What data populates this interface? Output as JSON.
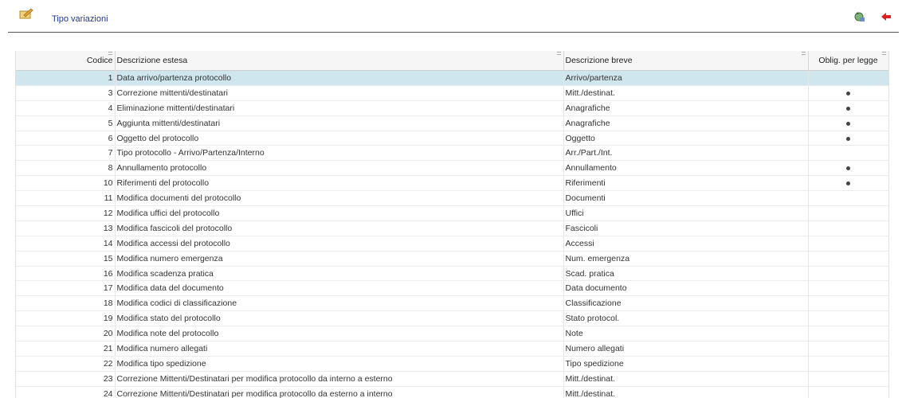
{
  "header": {
    "title": "Tipo variazioni",
    "logo_icon": "edit-pencil-icon",
    "refresh_icon": "refresh-icon",
    "exit_icon": "exit-icon"
  },
  "table": {
    "columns": [
      "Codice",
      "Descrizione estesa",
      "Descrizione breve",
      "Oblig. per legge"
    ],
    "rows": [
      {
        "codice": "1",
        "estesa": "Data arrivo/partenza protocollo",
        "breve": "Arrivo/partenza",
        "obblig": false,
        "selected": true
      },
      {
        "codice": "3",
        "estesa": "Correzione mittenti/destinatari",
        "breve": "Mitt./destinat.",
        "obblig": true
      },
      {
        "codice": "4",
        "estesa": "Eliminazione mittenti/destinatari",
        "breve": "Anagrafiche",
        "obblig": true
      },
      {
        "codice": "5",
        "estesa": "Aggiunta mittenti/destinatari",
        "breve": "Anagrafiche",
        "obblig": true
      },
      {
        "codice": "6",
        "estesa": "Oggetto del protocollo",
        "breve": "Oggetto",
        "obblig": true
      },
      {
        "codice": "7",
        "estesa": "Tipo protocollo - Arrivo/Partenza/Interno",
        "breve": "Arr./Part./Int.",
        "obblig": false
      },
      {
        "codice": "8",
        "estesa": "Annullamento protocollo",
        "breve": "Annullamento",
        "obblig": true
      },
      {
        "codice": "10",
        "estesa": "Riferimenti del protocollo",
        "breve": "Riferimenti",
        "obblig": true
      },
      {
        "codice": "11",
        "estesa": "Modifica documenti del protocollo",
        "breve": "Documenti",
        "obblig": false
      },
      {
        "codice": "12",
        "estesa": "Modifica uffici del protocollo",
        "breve": "Uffici",
        "obblig": false
      },
      {
        "codice": "13",
        "estesa": "Modifica fascicoli del protocollo",
        "breve": "Fascicoli",
        "obblig": false
      },
      {
        "codice": "14",
        "estesa": "Modifica accessi del protocollo",
        "breve": "Accessi",
        "obblig": false
      },
      {
        "codice": "15",
        "estesa": "Modifica numero emergenza",
        "breve": "Num. emergenza",
        "obblig": false
      },
      {
        "codice": "16",
        "estesa": "Modifica scadenza pratica",
        "breve": "Scad. pratica",
        "obblig": false
      },
      {
        "codice": "17",
        "estesa": "Modifica data del documento",
        "breve": "Data documento",
        "obblig": false
      },
      {
        "codice": "18",
        "estesa": "Modifica codici di classificazione",
        "breve": "Classificazione",
        "obblig": false
      },
      {
        "codice": "19",
        "estesa": "Modifica stato del protocollo",
        "breve": "Stato protocol.",
        "obblig": false
      },
      {
        "codice": "20",
        "estesa": "Modifica note del protocollo",
        "breve": "Note",
        "obblig": false
      },
      {
        "codice": "21",
        "estesa": "Modifica numero allegati",
        "breve": "Numero allegati",
        "obblig": false
      },
      {
        "codice": "22",
        "estesa": "Modifica tipo spedizione",
        "breve": "Tipo spedizione",
        "obblig": false
      },
      {
        "codice": "23",
        "estesa": "Correzione Mittenti/Destinatari per modifica protocollo da interno a esterno",
        "breve": "Mitt./destinat.",
        "obblig": false
      },
      {
        "codice": "24",
        "estesa": "Correzione Mittenti/Destinatari per modifica protocollo da esterno a interno",
        "breve": "Mitt./destinat.",
        "obblig": false
      }
    ]
  }
}
